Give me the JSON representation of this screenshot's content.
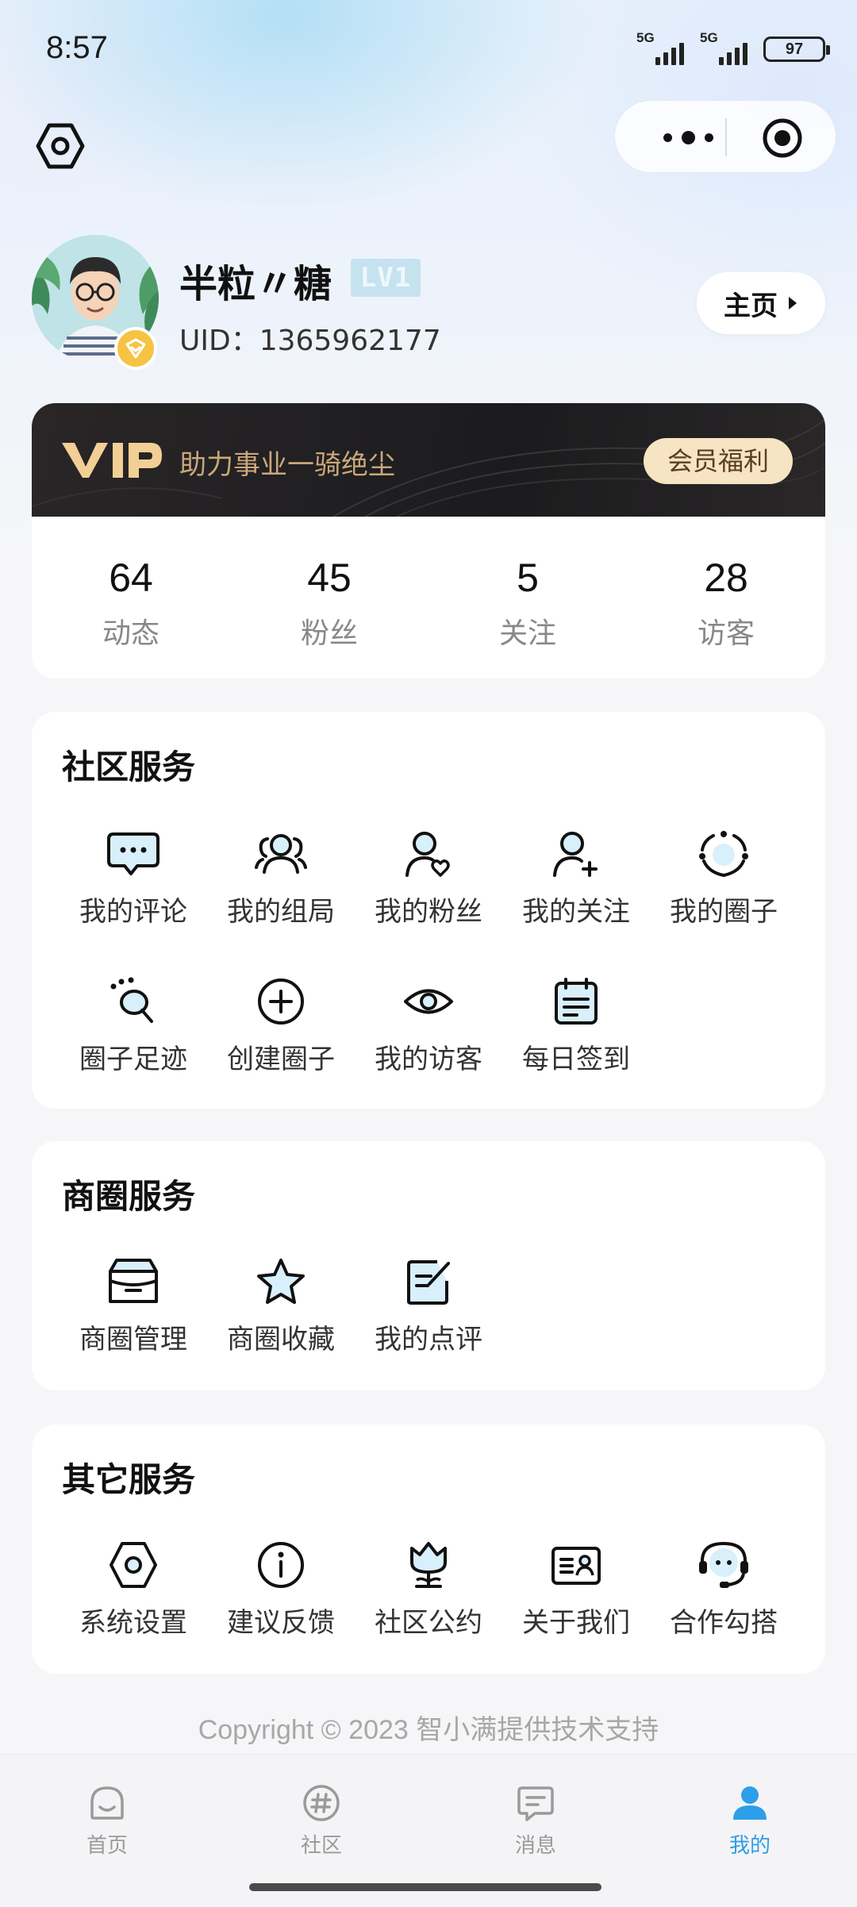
{
  "status_bar": {
    "time": "8:57",
    "sim1": "5G",
    "sim2": "5G",
    "battery": "97"
  },
  "profile": {
    "nickname": "半粒〃糖",
    "level": "LV1",
    "uid": "UID：1365962177",
    "home_button": "主页"
  },
  "vip": {
    "logo": "VIP",
    "slogan": "助力事业一骑绝尘",
    "button": "会员福利"
  },
  "stats": [
    {
      "value": "64",
      "label": "动态"
    },
    {
      "value": "45",
      "label": "粉丝"
    },
    {
      "value": "5",
      "label": "关注"
    },
    {
      "value": "28",
      "label": "访客"
    }
  ],
  "community": {
    "title": "社区服务",
    "items": [
      {
        "label": "我的评论",
        "icon": "comment-icon"
      },
      {
        "label": "我的组局",
        "icon": "group-icon"
      },
      {
        "label": "我的粉丝",
        "icon": "fans-icon"
      },
      {
        "label": "我的关注",
        "icon": "follow-icon"
      },
      {
        "label": "我的圈子",
        "icon": "circle-icon"
      },
      {
        "label": "圈子足迹",
        "icon": "footprint-icon"
      },
      {
        "label": "创建圈子",
        "icon": "add-circle-icon"
      },
      {
        "label": "我的访客",
        "icon": "eye-icon"
      },
      {
        "label": "每日签到",
        "icon": "calendar-icon"
      }
    ]
  },
  "business": {
    "title": "商圈服务",
    "items": [
      {
        "label": "商圈管理",
        "icon": "store-icon"
      },
      {
        "label": "商圈收藏",
        "icon": "star-icon"
      },
      {
        "label": "我的点评",
        "icon": "review-icon"
      }
    ]
  },
  "other": {
    "title": "其它服务",
    "items": [
      {
        "label": "系统设置",
        "icon": "settings-icon"
      },
      {
        "label": "建议反馈",
        "icon": "info-icon"
      },
      {
        "label": "社区公约",
        "icon": "tulip-icon"
      },
      {
        "label": "关于我们",
        "icon": "about-card-icon"
      },
      {
        "label": "合作勾搭",
        "icon": "headset-icon"
      }
    ]
  },
  "copyright": "Copyright © 2023 智小满提供技术支持",
  "tabbar": {
    "active": "我的",
    "tabs": [
      {
        "label": "首页",
        "icon": "home-icon"
      },
      {
        "label": "社区",
        "icon": "hashtag-icon"
      },
      {
        "label": "消息",
        "icon": "message-icon"
      },
      {
        "label": "我的",
        "icon": "user-icon"
      }
    ]
  },
  "colors": {
    "accent": "#2d9ee8",
    "icon_fill": "#d8f0fb",
    "vip_gold": "#c9a87a"
  }
}
